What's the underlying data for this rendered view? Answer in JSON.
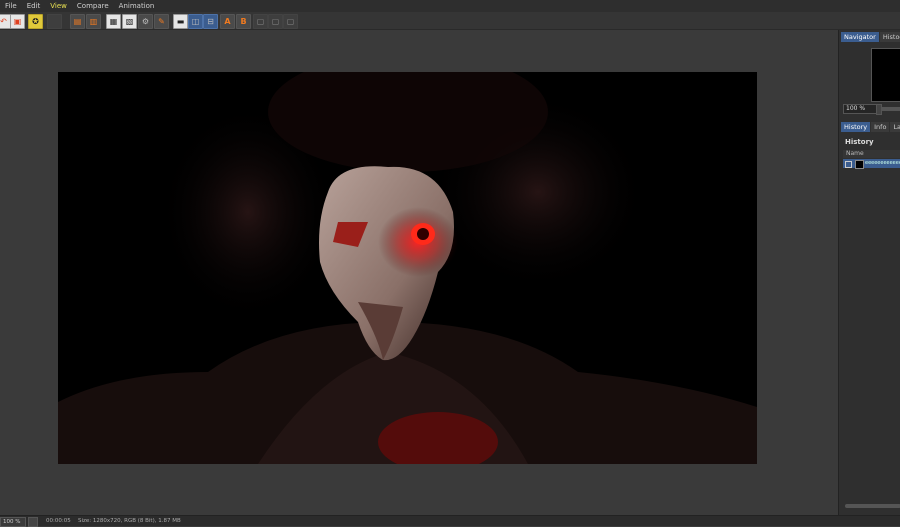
{
  "menu": {
    "items": [
      {
        "label": "File"
      },
      {
        "label": "Edit"
      },
      {
        "label": "View"
      },
      {
        "label": "Compare"
      },
      {
        "label": "Animation"
      }
    ],
    "active_index": 2
  },
  "toolbar": {
    "buttons": [
      {
        "name": "undo-button",
        "icon": "undo-arrow-icon"
      },
      {
        "name": "save-image-button",
        "icon": "save-image-icon"
      },
      {
        "name": "render-settings-button",
        "icon": "render-settings-icon"
      },
      {
        "name": "disabled-button",
        "icon": "blank-icon"
      },
      {
        "name": "open-image-button",
        "icon": "open-image-icon"
      },
      {
        "name": "save-as-button",
        "icon": "save-as-icon"
      },
      {
        "name": "copy-image-button",
        "icon": "copy-image-icon"
      },
      {
        "name": "region-button",
        "icon": "region-icon"
      },
      {
        "name": "group-button",
        "icon": "group-icon"
      },
      {
        "name": "edit-button",
        "icon": "edit-icon"
      },
      {
        "name": "ab-compare-button",
        "icon": "ab-compare-icon"
      },
      {
        "name": "split-view-button",
        "icon": "split-view-icon"
      },
      {
        "name": "split-view-horizontal-button",
        "icon": "split-horizontal-icon"
      },
      {
        "name": "set-a-button",
        "icon": "set-a-icon",
        "label": "A"
      },
      {
        "name": "set-b-button",
        "icon": "set-b-icon",
        "label": "B"
      },
      {
        "name": "layer-1-button",
        "icon": "layer-icon"
      },
      {
        "name": "layer-2-button",
        "icon": "layer-icon"
      },
      {
        "name": "layer-3-button",
        "icon": "layer-icon"
      }
    ]
  },
  "panel": {
    "top_tabs": [
      {
        "label": "Navigator",
        "active": true
      },
      {
        "label": "Histogram",
        "active": false
      }
    ],
    "zoom_value": "100 %",
    "second_tabs": [
      {
        "label": "History",
        "active": true
      },
      {
        "label": "Info",
        "active": false
      },
      {
        "label": "Layers",
        "active": false
      }
    ],
    "history_title": "History",
    "name_header": "Name",
    "history_row_text": "eeeeeeeeeeee"
  },
  "status": {
    "zoom": "100 %",
    "frame": "00:00:05",
    "info": "Size: 1280x720, RGB (8 Bit), 1.87 MB"
  },
  "colors": {
    "accent": "#3b5d8f",
    "active_menu": "#e8e052",
    "canvas": "#000000",
    "glow_red": "#ff1a1a"
  }
}
